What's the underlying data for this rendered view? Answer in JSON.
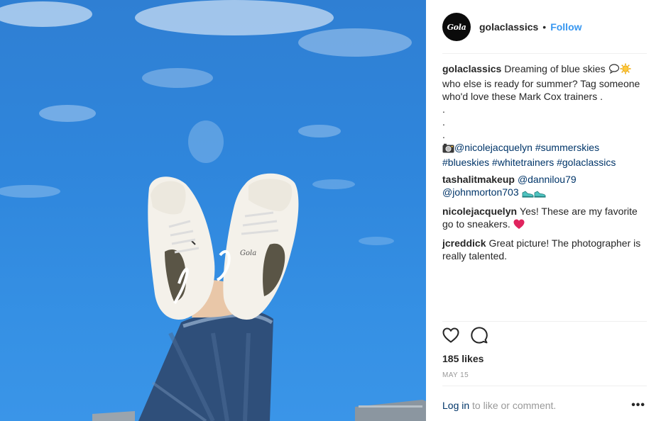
{
  "header": {
    "avatar_text": "Gola",
    "username": "golaclassics",
    "separator": "•",
    "follow_label": "Follow"
  },
  "caption": {
    "username": "golaclassics",
    "text_1": "Dreaming of blue skies",
    "text_2": "who else is ready for summer? Tag someone who'd love these Mark Cox trainers .",
    "dots": [
      ".",
      ".",
      "."
    ],
    "mention": "@nicolejacquelyn",
    "hashtags": [
      "#summerskies",
      "#blueskies",
      "#whitetrainers",
      "#golaclassics"
    ],
    "emojis": [
      "speech-bubble-icon",
      "sun-icon",
      "camera-icon"
    ]
  },
  "comments": [
    {
      "username": "tashalitmakeup",
      "mentions": [
        "@dannilou79",
        "@johnmorton703"
      ],
      "emojis": [
        "sneaker-icon",
        "sneaker-icon"
      ]
    },
    {
      "username": "nicolejacquelyn",
      "text": "Yes! These are my favorite go to sneakers.",
      "emojis": [
        "red-heart-icon"
      ]
    },
    {
      "username": "jcreddick",
      "text": "Great picture! The photographer is really talented."
    }
  ],
  "stats": {
    "likes": "185 likes",
    "date": "MAY 15"
  },
  "footer": {
    "login_label": "Log in",
    "prompt": "to like or comment.",
    "more_label": "•••"
  },
  "colors": {
    "link": "#003569",
    "follow": "#3897f0",
    "text": "#262626",
    "muted": "#999999",
    "sky": "#2f86dc"
  }
}
